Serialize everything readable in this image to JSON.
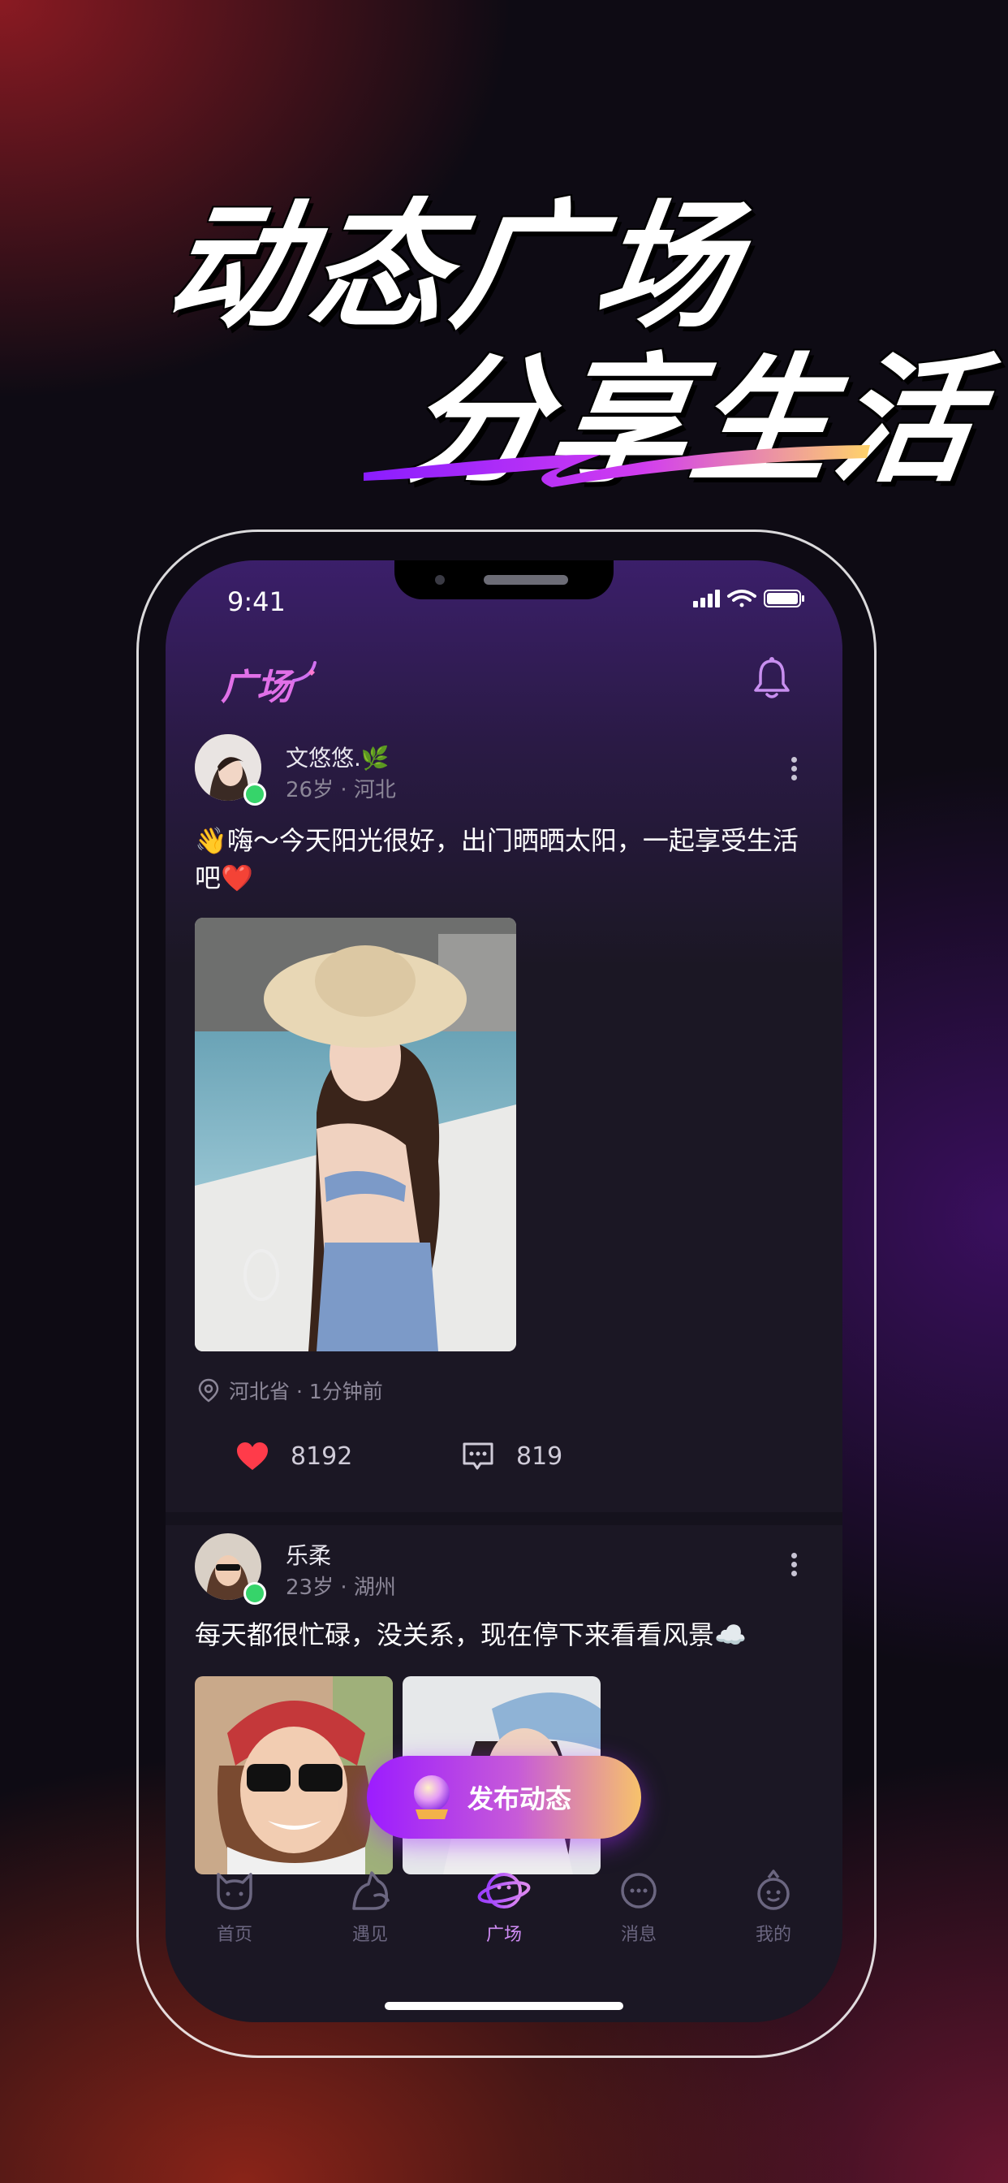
{
  "hero": {
    "line1": "动态广场",
    "line2": "分享生活"
  },
  "status_bar": {
    "time": "9:41"
  },
  "nav": {
    "title": "广场"
  },
  "posts": [
    {
      "name": "文悠悠.🌿",
      "meta": "26岁 · 河北",
      "text": "👋嗨～今天阳光很好，出门晒晒太阳，一起享受生活吧❤️",
      "location": "河北省 · 1分钟前",
      "likes": "8192",
      "comments": "819"
    },
    {
      "name": "乐柔",
      "meta": "23岁 · 湖州",
      "text": "每天都很忙碌，没关系，现在停下来看看风景☁️"
    }
  ],
  "fab": {
    "label": "发布动态"
  },
  "tabs": [
    {
      "label": "首页",
      "icon": "cat-face-icon"
    },
    {
      "label": "遇见",
      "icon": "cat-tail-icon"
    },
    {
      "label": "广场",
      "icon": "planet-icon",
      "active": true
    },
    {
      "label": "消息",
      "icon": "chat-bubble-icon"
    },
    {
      "label": "我的",
      "icon": "profile-face-icon"
    }
  ],
  "colors": {
    "accent": "#d08cf5",
    "like": "#ff3b4a",
    "online": "#36d46a"
  }
}
